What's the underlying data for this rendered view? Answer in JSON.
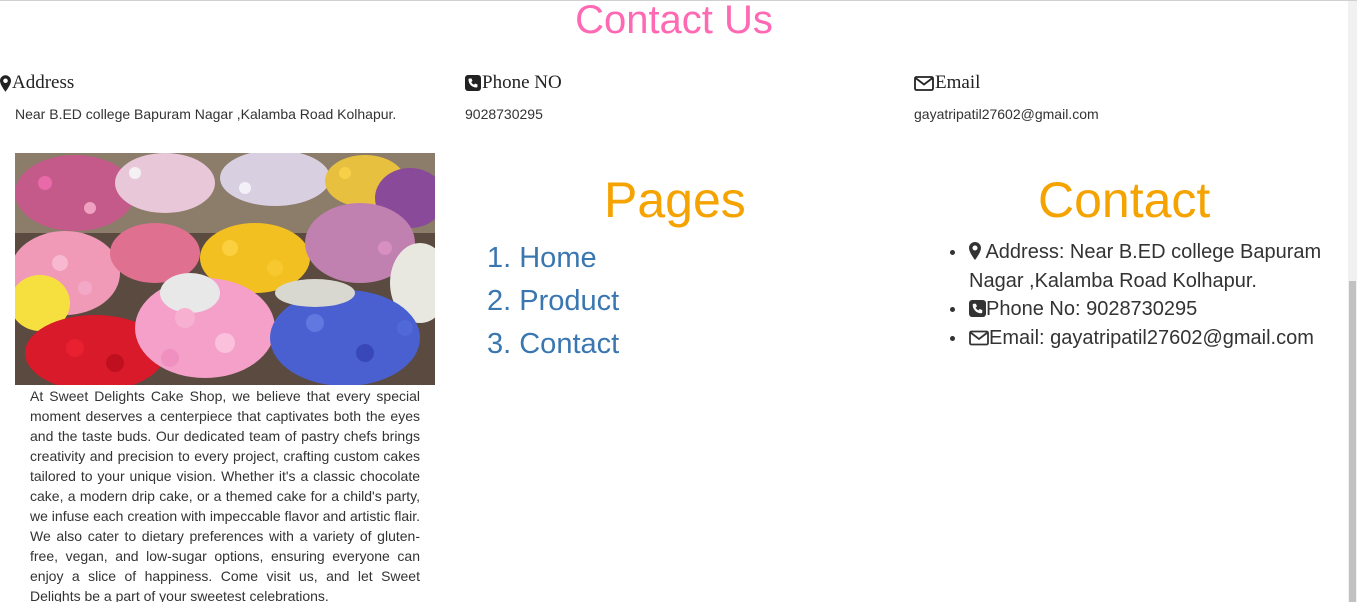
{
  "header": {
    "title": "Contact Us"
  },
  "info": {
    "address": {
      "label": "Address",
      "value": "Near B.ED college Bapuram Nagar ,Kalamba Road Kolhapur."
    },
    "phone": {
      "label": "Phone NO",
      "value": "9028730295"
    },
    "email": {
      "label": "Email",
      "value": "gayatripatil27602@gmail.com"
    }
  },
  "about": {
    "text": "At Sweet Delights Cake Shop, we believe that every special moment deserves a centerpiece that captivates both the eyes and the taste buds. Our dedicated team of pastry chefs brings creativity and precision to every project, crafting custom cakes tailored to your unique vision. Whether it's a classic chocolate cake, a modern drip cake, or a themed cake for a child's party, we infuse each creation with impeccable flavor and artistic flair. We also cater to dietary preferences with a variety of gluten-free, vegan, and low-sugar options, ensuring everyone can enjoy a slice of happiness. Come visit us, and let Sweet Delights be a part of your sweetest celebrations."
  },
  "pages": {
    "title": "Pages",
    "items": [
      {
        "label": "1. Home"
      },
      {
        "label": "2. Product"
      },
      {
        "label": "3. Contact"
      }
    ]
  },
  "contact": {
    "title": "Contact",
    "address": "Address: Near B.ED college Bapuram Nagar ,Kalamba Road Kolhapur.",
    "phone": "Phone No: 9028730295",
    "email": "Email: gayatripatil27602@gmail.com"
  },
  "colors": {
    "heading_pink": "#ff69b4",
    "heading_orange": "#f5a300",
    "link_blue": "#3a77b0"
  }
}
